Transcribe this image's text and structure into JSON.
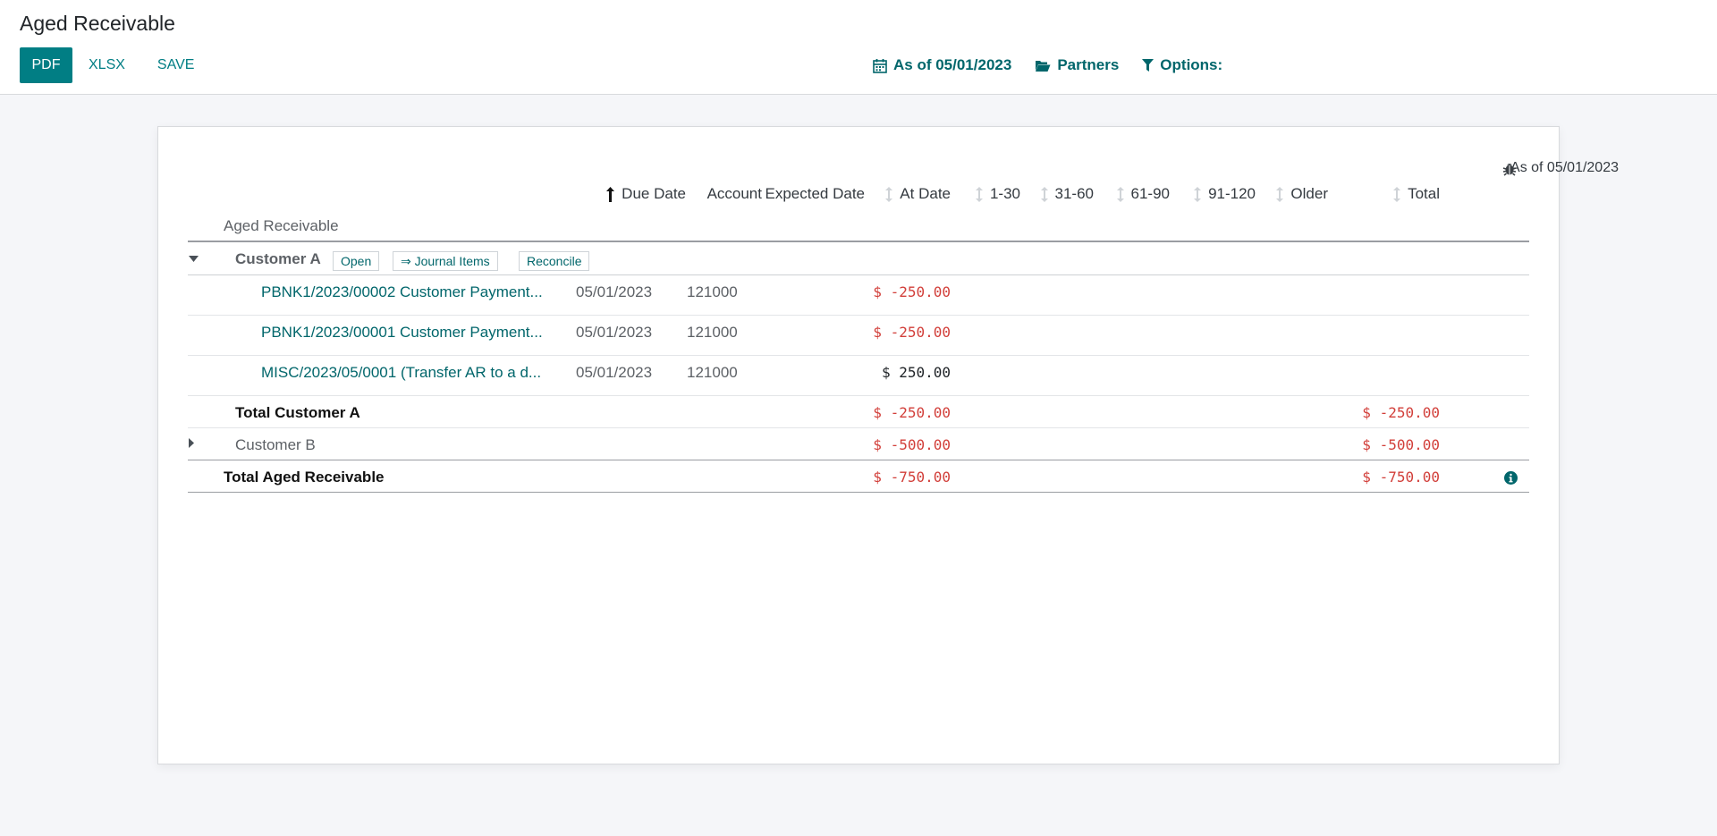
{
  "header": {
    "title": "Aged Receivable",
    "buttons": {
      "pdf": "PDF",
      "xlsx": "XLSX",
      "save": "SAVE"
    },
    "filters": {
      "date": "As of 05/01/2023",
      "partners": "Partners",
      "options": "Options:"
    }
  },
  "report": {
    "as_of": "As of 05/01/2023",
    "name": "Aged Receivable",
    "columns": {
      "due_date": "Due Date",
      "account": "Account",
      "expected_date": "Expected Date",
      "at_date": "At Date",
      "b1_30": "1-30",
      "b31_60": "31-60",
      "b61_90": "61-90",
      "b91_120": "91-120",
      "older": "Older",
      "total": "Total"
    },
    "customer_a": {
      "name": "Customer A",
      "actions": {
        "open": "Open",
        "journal_items": "⇒ Journal Items",
        "reconcile": "Reconcile"
      },
      "lines": [
        {
          "ref": "PBNK1/2023/00002 Customer Payment...",
          "due": "05/01/2023",
          "account": "121000",
          "at_date": "$ -250.00"
        },
        {
          "ref": "PBNK1/2023/00001 Customer Payment...",
          "due": "05/01/2023",
          "account": "121000",
          "at_date": "$ -250.00"
        },
        {
          "ref": "MISC/2023/05/0001 (Transfer AR to a d...",
          "due": "05/01/2023",
          "account": "121000",
          "at_date": "$ 250.00"
        }
      ],
      "total_label": "Total Customer A",
      "total_at_date": "$ -250.00",
      "total_total": "$ -250.00"
    },
    "customer_b": {
      "name": "Customer B",
      "at_date": "$ -500.00",
      "total": "$ -500.00"
    },
    "grand_total": {
      "label": "Total Aged Receivable",
      "at_date": "$ -750.00",
      "total": "$ -750.00"
    }
  },
  "colors": {
    "primary": "#017e84",
    "link": "#01666b",
    "negative": "#d23f3a"
  },
  "icons": {
    "date_filter": "calendar-icon",
    "partners_filter": "folder-open-icon",
    "options_filter": "filter-icon",
    "debug": "bug-icon",
    "info": "info-icon",
    "sort_active": "arrow-up-icon",
    "sort_inactive": "sort-icon"
  }
}
